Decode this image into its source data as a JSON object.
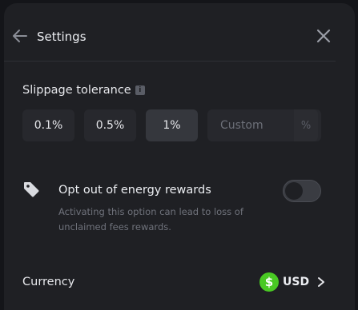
{
  "header": {
    "title": "Settings",
    "back_icon": "arrow-left-icon",
    "close_icon": "close-icon"
  },
  "slippage": {
    "title": "Slippage tolerance",
    "info_icon": "info-icon",
    "options": [
      "0.1%",
      "0.5%",
      "1%"
    ],
    "selected": "1%",
    "custom_placeholder": "Custom",
    "custom_suffix": "%"
  },
  "energy": {
    "icon": "tag-icon",
    "label": "Opt out of energy rewards",
    "description": "Activating this option can lead to loss of unclaimed fees rewards.",
    "enabled": false
  },
  "currency": {
    "label": "Currency",
    "icon": "dollar-icon",
    "symbol": "$",
    "code": "USD",
    "chevron": "chevron-right-icon"
  },
  "colors": {
    "panel_bg": "#1f2024",
    "accent_green": "#49c923",
    "button_bg": "#27282d",
    "selected_bg": "#35373d"
  }
}
